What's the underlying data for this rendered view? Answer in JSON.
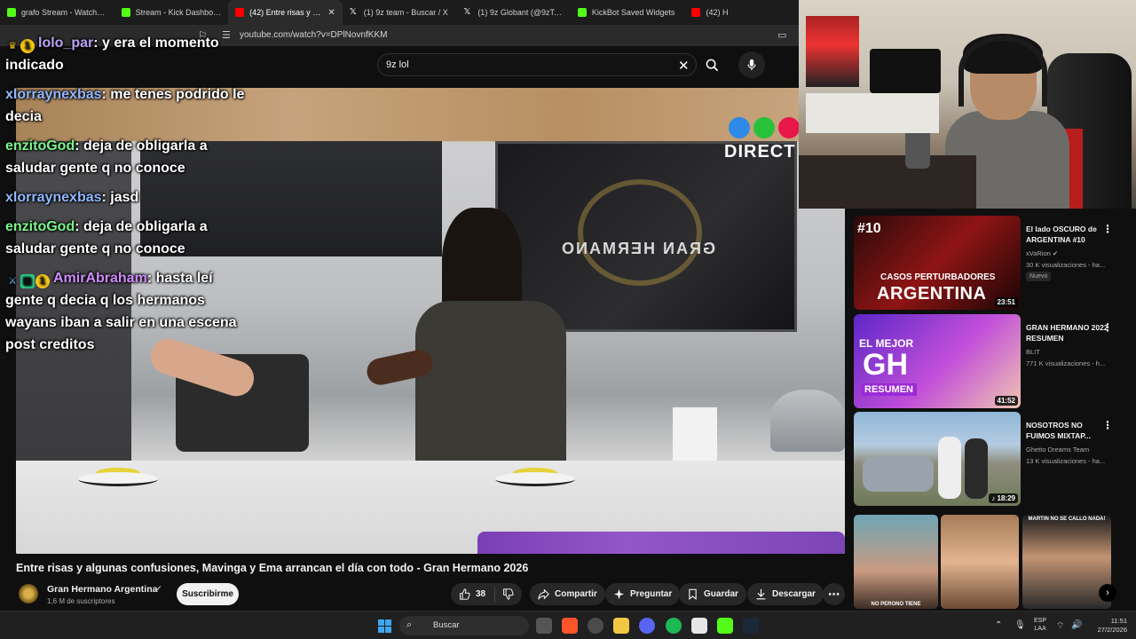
{
  "browser": {
    "tabs": [
      {
        "label": "grafo Stream - Watch Live",
        "color": "#53fc18",
        "active": false
      },
      {
        "label": "Stream - Kick Dashboard",
        "color": "#53fc18",
        "active": false
      },
      {
        "label": "(42) Entre risas y alguna",
        "color": "#ff0000",
        "active": true
      },
      {
        "label": "(1) 9z team - Buscar / X",
        "color": "#ffffff",
        "active": false
      },
      {
        "label": "(1) 9z Globant (@9zTeam) / X",
        "color": "#ffffff",
        "active": false
      },
      {
        "label": "KickBot Saved Widgets",
        "color": "#53fc18",
        "active": false
      },
      {
        "label": "(42) H",
        "color": "#ff0000",
        "active": false
      }
    ],
    "url": "youtube.com/watch?v=DPlNovnfKKM"
  },
  "youtube": {
    "search_query": "9z lol",
    "video": {
      "channel_logo_text": "DIRECT",
      "title": "Entre risas y algunas confusiones, Mavinga y Ema arrancan el día con todo - Gran Hermano 2026",
      "channel": "Gran Hermano Argentina",
      "subscribers": "1,6 M de suscriptores",
      "subscribe_label": "Suscribirme",
      "likes": "38",
      "share_label": "Compartir",
      "ask_label": "Preguntar",
      "save_label": "Guardar",
      "download_label": "Descargar"
    },
    "recommendations": [
      {
        "title": "El lado OSCURO de ARGENTINA #10",
        "channel": "xVaRion",
        "views": "30 K visualizaciones - ha...",
        "badge": "Nuevo",
        "duration": "23:51",
        "thumb_number": "#10",
        "thumb_sub": "CASOS PERTURBADORES",
        "thumb_big": "ARGENTINA"
      },
      {
        "title": "GRAN HERMANO 2022 RESUMEN",
        "channel": "BLIT",
        "views": "771 K visualizaciones - h...",
        "badge": "",
        "duration": "41:52",
        "thumb_top": "EL MEJOR",
        "thumb_big": "GH",
        "thumb_sub": "RESUMEN"
      },
      {
        "title": "NOSOTROS NO FUIMOS MIXTAP...",
        "channel": "Ghetto Dreams Team",
        "views": "13 K visualizaciones - ha...",
        "badge": "",
        "duration": "18:29"
      }
    ],
    "reel_captions": {
      "left": "NO PERONO TIENE",
      "right": "MARTIN NO SE CALLO NADA!"
    }
  },
  "chat": [
    {
      "user": "lolo_par",
      "color": "#b9a3f5",
      "text": "y era el momento indicado",
      "badges": [
        "crown",
        "1"
      ]
    },
    {
      "user": "xlorraynexbas",
      "color": "#8fb8ff",
      "text": "me tenes podrido le decia",
      "badges": []
    },
    {
      "user": "enzitoGod",
      "color": "#79f58a",
      "text": "deja de obligarla a saludar gente q no conoce",
      "badges": []
    },
    {
      "user": "xlorraynexbas",
      "color": "#8fb8ff",
      "text": "jasd",
      "badges": []
    },
    {
      "user": "enzitoGod",
      "color": "#79f58a",
      "text": "deja de obligarla a saludar gente q no conoce",
      "badges": []
    },
    {
      "user": "AmirAbraham",
      "color": "#d08cff",
      "text": "hasta leí gente q decia q los hermanos wayans iban a salir en una escena post creditos",
      "badges": [
        "sword",
        "grid",
        "1"
      ]
    }
  ],
  "taskbar": {
    "search_label": "Buscar",
    "lang_top": "ESP",
    "lang_bottom": "LAA",
    "time": "11:51",
    "date": "27/2/2026"
  }
}
